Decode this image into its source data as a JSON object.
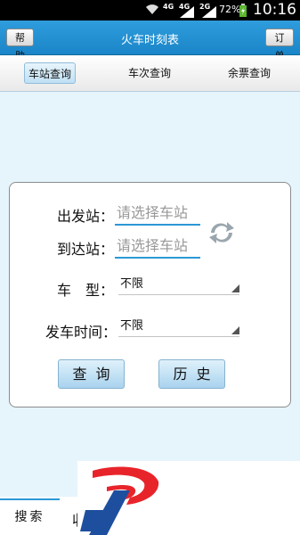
{
  "status_bar": {
    "net1": "4G",
    "net2": "4G",
    "net3": "2G",
    "battery": "72%",
    "time": "10:16"
  },
  "title_bar": {
    "help": "帮 助",
    "title": "火车时刻表",
    "orders": "订 单"
  },
  "tabs": [
    {
      "label": "车站查询",
      "active": true
    },
    {
      "label": "车次查询",
      "active": false
    },
    {
      "label": "余票查询",
      "active": false
    }
  ],
  "form": {
    "from_label": "出发站：",
    "from_placeholder": "请选择车站",
    "to_label": "到达站：",
    "to_placeholder": "请选择车站",
    "type_label": "车　型：",
    "type_value": "不限",
    "time_label": "发车时间：",
    "time_value": "不限",
    "query_button": "查询",
    "history_button": "历史"
  },
  "bottom": {
    "search_tab": "搜索",
    "partial_glyph": "收"
  },
  "colors": {
    "accent": "#1a85c8",
    "background": "#e6f4fc",
    "button": "#bfe0f4",
    "logo_red": "#e8242b",
    "logo_blue": "#1d4f9e"
  }
}
